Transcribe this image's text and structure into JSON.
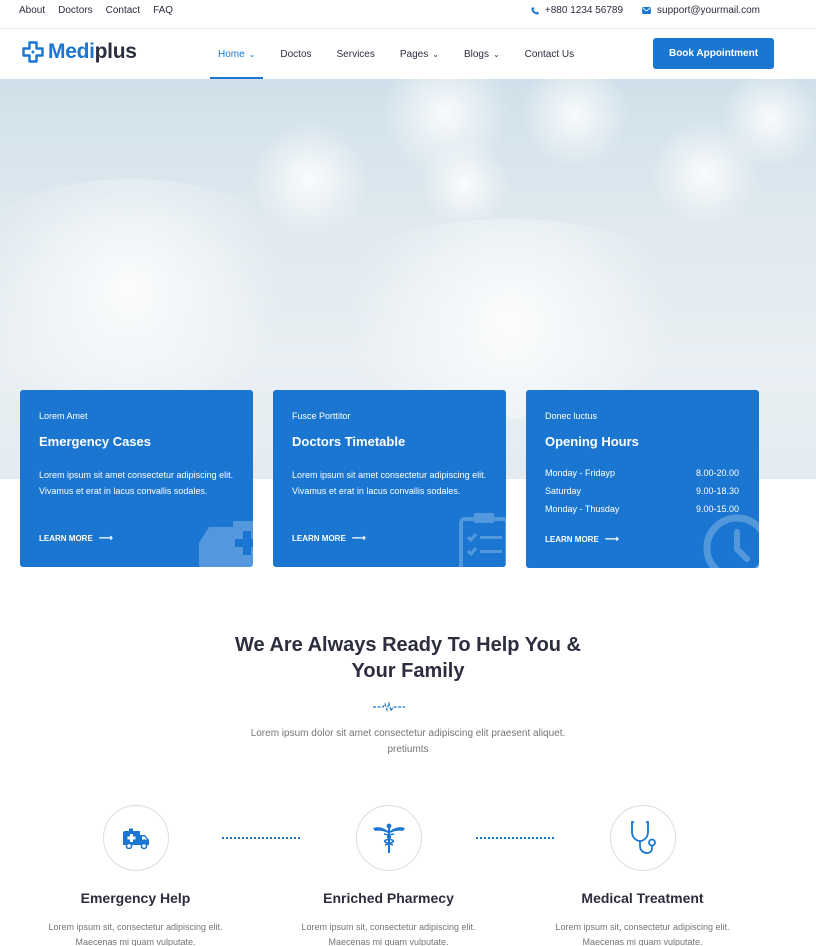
{
  "topbar": {
    "links": [
      "About",
      "Doctors",
      "Contact",
      "FAQ"
    ],
    "phone": "+880 1234 56789",
    "email": "support@yourmail.com"
  },
  "logo": {
    "part1": "Medi",
    "part2": "plus"
  },
  "nav": {
    "items": [
      {
        "label": "Home",
        "has_dropdown": true,
        "active": true
      },
      {
        "label": "Doctos",
        "has_dropdown": false,
        "active": false
      },
      {
        "label": "Services",
        "has_dropdown": false,
        "active": false
      },
      {
        "label": "Pages",
        "has_dropdown": true,
        "active": false
      },
      {
        "label": "Blogs",
        "has_dropdown": true,
        "active": false
      },
      {
        "label": "Contact Us",
        "has_dropdown": false,
        "active": false
      }
    ],
    "cta": "Book Appointment"
  },
  "cards": [
    {
      "kicker": "Lorem Amet",
      "title": "Emergency Cases",
      "desc": "Lorem ipsum sit amet consectetur adipiscing elit. Vivamus et erat in lacus convallis sodales.",
      "more": "LEARN MORE",
      "icon": "ambulance-icon"
    },
    {
      "kicker": "Fusce Porttitor",
      "title": "Doctors Timetable",
      "desc": "Lorem ipsum sit amet consectetur adipiscing elit. Vivamus et erat in lacus convallis sodales.",
      "more": "LEARN MORE",
      "icon": "clipboard-icon"
    },
    {
      "kicker": "Donec luctus",
      "title": "Opening Hours",
      "hours": [
        {
          "day": "Monday - Fridayp",
          "time": "8.00-20.00"
        },
        {
          "day": "Saturday",
          "time": "9.00-18.30"
        },
        {
          "day": "Monday - Thusday",
          "time": "9.00-15.00"
        }
      ],
      "more": "LEARN MORE",
      "icon": "clock-icon"
    }
  ],
  "section": {
    "title_line1": "We Are Always Ready To Help You &",
    "title_line2": "Your Family",
    "subtitle_line1": "Lorem ipsum dolor sit amet consectetur adipiscing elit praesent aliquet.",
    "subtitle_line2": "pretiumts"
  },
  "services": [
    {
      "name": "Emergency Help",
      "desc_line1": "Lorem ipsum sit, consectetur adipiscing elit.",
      "desc_line2": "Maecenas mi quam vulputate.",
      "icon": "ambulance-icon"
    },
    {
      "name": "Enriched Pharmecy",
      "desc_line1": "Lorem ipsum sit, consectetur adipiscing elit.",
      "desc_line2": "Maecenas mi quam vulputate.",
      "icon": "caduceus-icon"
    },
    {
      "name": "Medical Treatment",
      "desc_line1": "Lorem ipsum sit, consectetur adipiscing elit.",
      "desc_line2": "Maecenas mi quam vulputate.",
      "icon": "stethoscope-icon"
    }
  ],
  "colors": {
    "primary": "#1a76d1",
    "text": "#2c2d3f",
    "muted": "#757575"
  }
}
